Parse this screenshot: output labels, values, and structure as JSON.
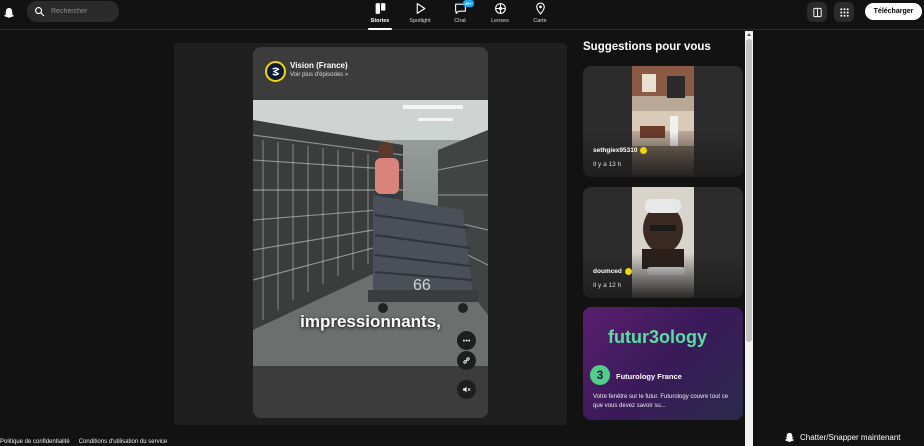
{
  "search": {
    "placeholder": "Rechercher"
  },
  "nav": {
    "items": [
      {
        "label": "Stories",
        "icon": "stories-icon",
        "active": true
      },
      {
        "label": "Spotlight",
        "icon": "spotlight-icon"
      },
      {
        "label": "Chat",
        "icon": "chat-icon",
        "badge": "99+"
      },
      {
        "label": "Lenses",
        "icon": "lenses-icon"
      },
      {
        "label": "Carte",
        "icon": "map-pin-icon"
      }
    ]
  },
  "toolbar": {
    "download_label": "Télécharger"
  },
  "story": {
    "publisher": "Vision (France)",
    "more_episodes": "Voir plus d'épisodes »",
    "caption": "impressionnants,",
    "box_label": "66"
  },
  "suggestions": {
    "title": "Suggestions pour vous",
    "cards": [
      {
        "user": "sethgiex95310",
        "time": "Il y a 13 h"
      },
      {
        "user": "doumced",
        "time": "Il y a 12 h"
      },
      {
        "title": "futur3ology",
        "name": "Futurology France",
        "logo": "3",
        "desc": "Votre fenêtre sur le futur. Futurology couvre tout ce que vous devez savoir su..."
      }
    ]
  },
  "footer": {
    "privacy": "Politique de confidentialité",
    "terms": "Conditions d'utilisation du service",
    "chat_now": "Chatter/Snapper maintenant"
  },
  "colors": {
    "accent_yellow": "#f2d700",
    "chat_badge": "#0fadff",
    "futurology_green": "#55e0a0"
  }
}
